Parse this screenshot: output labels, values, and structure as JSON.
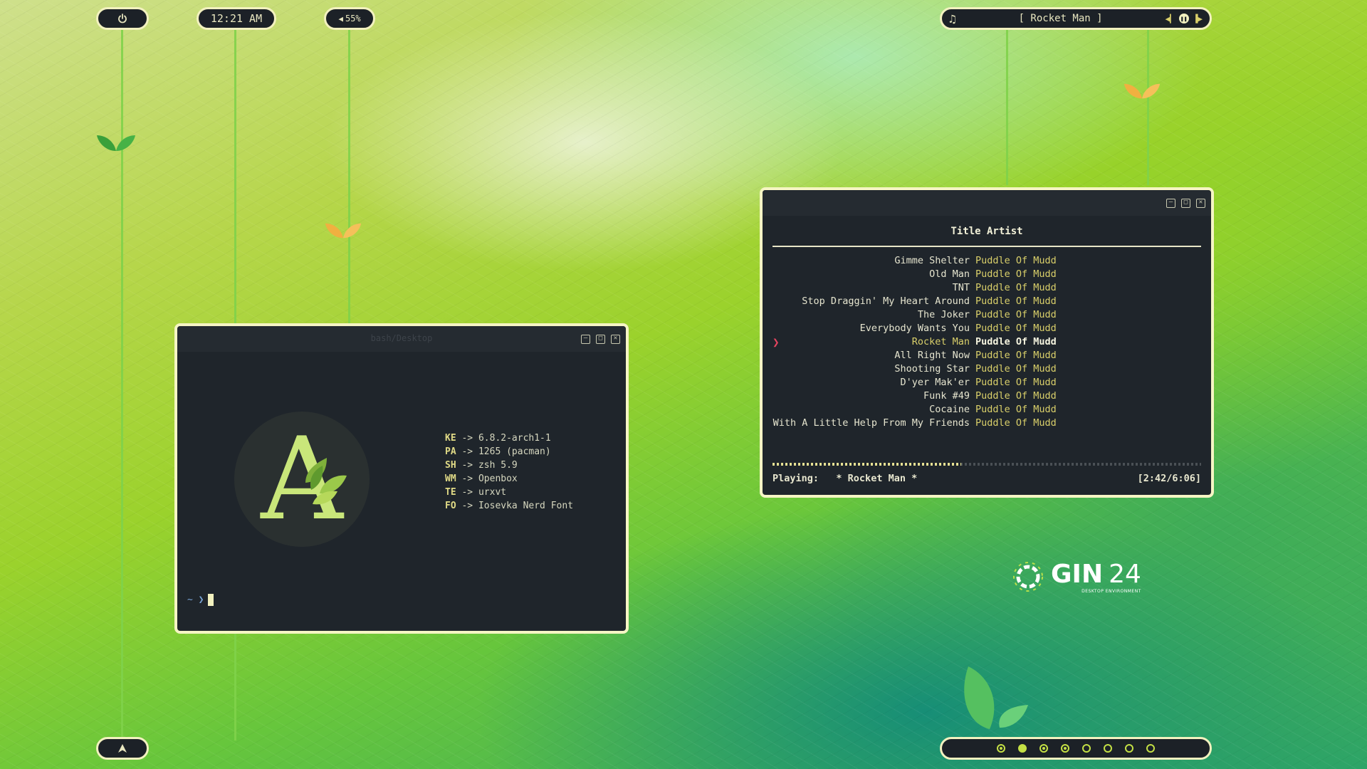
{
  "clock": {
    "time": "12:21 AM"
  },
  "volume": {
    "label": "55%"
  },
  "music_bar": {
    "title": "[ Rocket Man ]"
  },
  "terminal": {
    "title": "bash/Desktop",
    "fetch": [
      {
        "key": "KE",
        "arrow": "->",
        "value": "6.8.2-arch1-1"
      },
      {
        "key": "PA",
        "arrow": "->",
        "value": "1265 (pacman)"
      },
      {
        "key": "SH",
        "arrow": "->",
        "value": "zsh 5.9"
      },
      {
        "key": "WM",
        "arrow": "->",
        "value": "Openbox"
      },
      {
        "key": "TE",
        "arrow": "->",
        "value": "urxvt"
      },
      {
        "key": "FO",
        "arrow": "->",
        "value": "Iosevka Nerd Font"
      }
    ],
    "logo_letter": "A",
    "prompt": "~ ❯"
  },
  "player": {
    "header": "Title Artist",
    "tracks": [
      {
        "title": "Gimme Shelter",
        "artist": "Puddle Of Mudd"
      },
      {
        "title": "Old Man",
        "artist": "Puddle Of Mudd"
      },
      {
        "title": "TNT",
        "artist": "Puddle Of Mudd"
      },
      {
        "title": "Stop Draggin' My Heart Around",
        "artist": "Puddle Of Mudd"
      },
      {
        "title": "The Joker",
        "artist": "Puddle Of Mudd"
      },
      {
        "title": "Everybody Wants You",
        "artist": "Puddle Of Mudd"
      },
      {
        "title": "Rocket Man",
        "artist": "Puddle Of Mudd",
        "current": true
      },
      {
        "title": "All Right Now",
        "artist": "Puddle Of Mudd"
      },
      {
        "title": "Shooting Star",
        "artist": "Puddle Of Mudd"
      },
      {
        "title": "D'yer Mak'er",
        "artist": "Puddle Of Mudd"
      },
      {
        "title": "Funk #49",
        "artist": "Puddle Of Mudd"
      },
      {
        "title": "Cocaine",
        "artist": "Puddle Of Mudd"
      },
      {
        "title": "With A Little Help From My Friends",
        "artist": "Puddle Of Mudd"
      }
    ],
    "progress": 0.44,
    "playing_label": "Playing:",
    "playing_title": "* Rocket Man *",
    "time": "[2:42/6:06]"
  },
  "brand": {
    "name": "GIN",
    "version": "24",
    "tagline": "DESKTOP ENVIRONMENT"
  },
  "workspaces": [
    "mid",
    "active",
    "mid",
    "mid",
    "empty",
    "empty",
    "empty",
    "empty"
  ],
  "colors": {
    "accent": "#c4e045",
    "border": "#f2f1bf",
    "panel": "#1f252b",
    "highlight": "#dad06a",
    "caret": "#e64560"
  }
}
